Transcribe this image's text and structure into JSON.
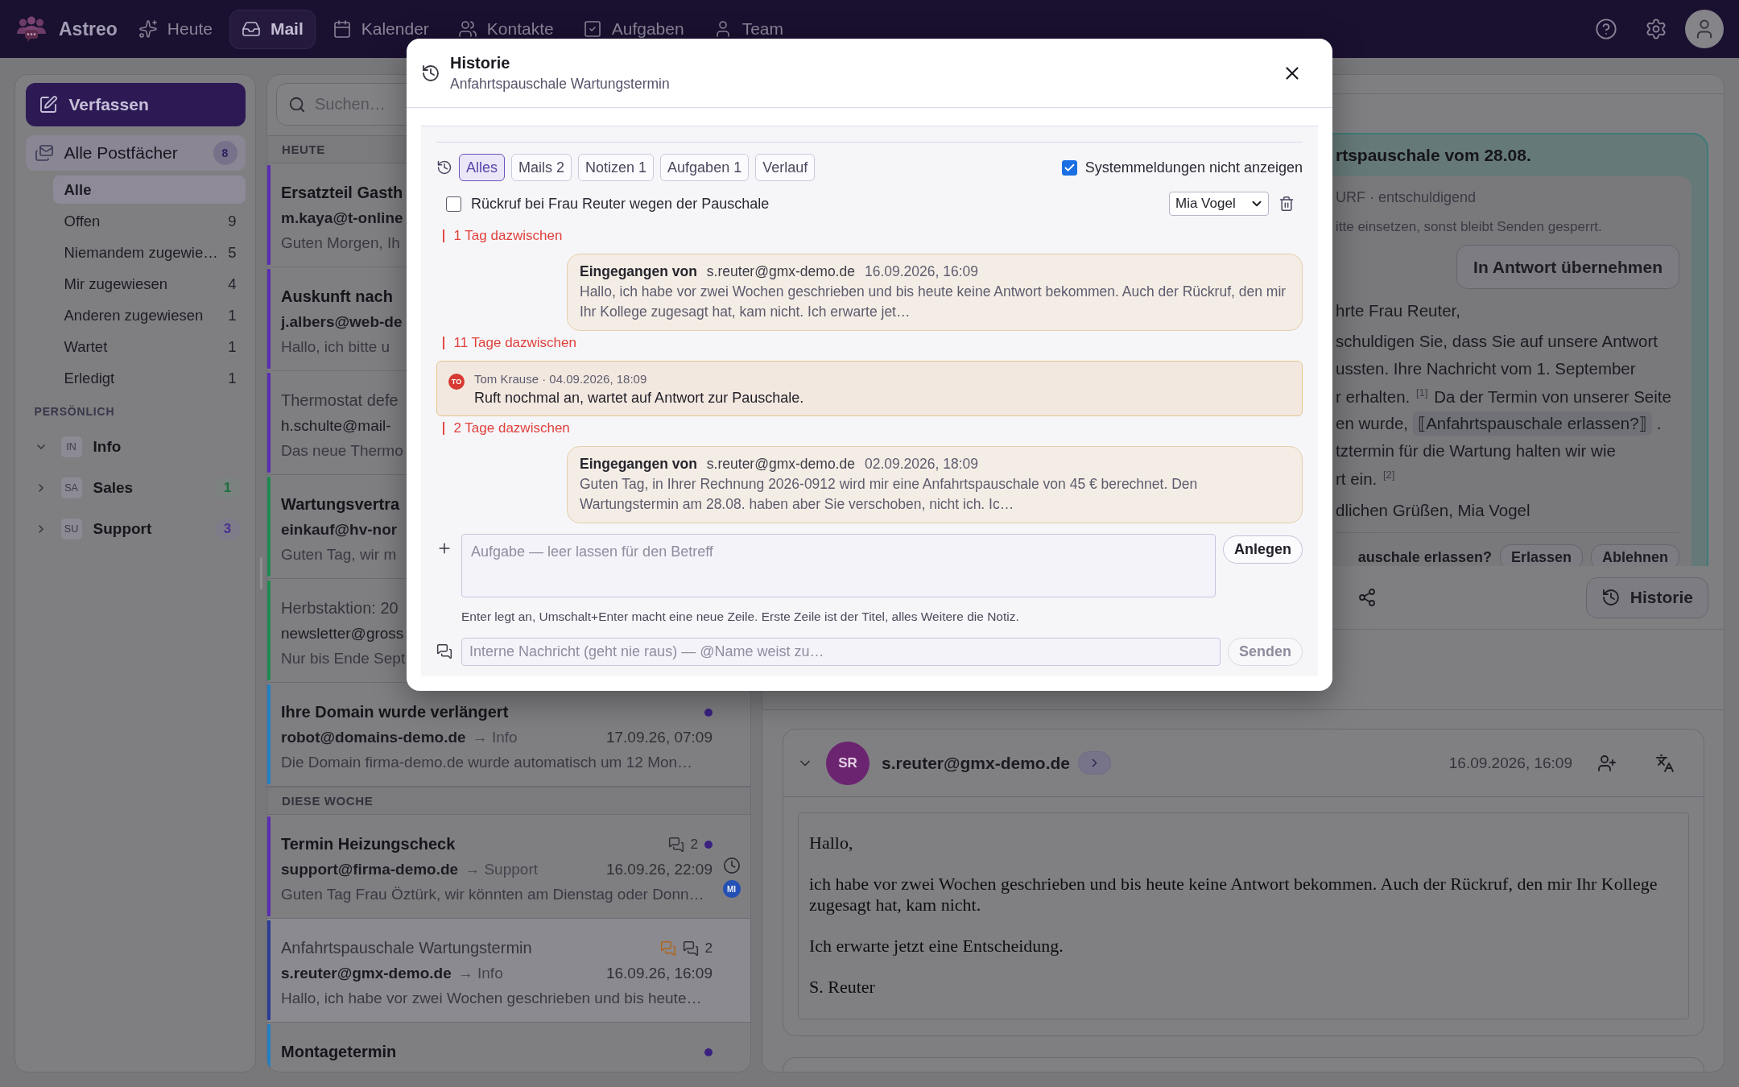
{
  "app": {
    "name": "Astreo"
  },
  "nav": [
    {
      "label": "Heute",
      "selected": false
    },
    {
      "label": "Mail",
      "selected": true
    },
    {
      "label": "Kalender",
      "selected": false
    },
    {
      "label": "Kontakte",
      "selected": false
    },
    {
      "label": "Aufgaben",
      "selected": false
    },
    {
      "label": "Team",
      "selected": false
    }
  ],
  "sidebar": {
    "compose": "Verfassen",
    "all_mailboxes": {
      "label": "Alle Postfächer",
      "count": "8",
      "selected": true
    },
    "filters": [
      {
        "label": "Alle",
        "selected": true
      },
      {
        "label": "Offen",
        "count": "9",
        "selected": false
      },
      {
        "label": "Niemandem zugewie…",
        "count": "5",
        "selected": false
      },
      {
        "label": "Mir zugewiesen",
        "count": "4",
        "selected": false
      },
      {
        "label": "Anderen zugewiesen",
        "count": "1",
        "selected": false
      },
      {
        "label": "Wartet",
        "count": "1",
        "selected": false
      },
      {
        "label": "Erledigt",
        "count": "1",
        "selected": false
      }
    ],
    "section": "PERSÖNLICH",
    "mailboxes": [
      {
        "code": "IN",
        "name": "Info",
        "expanded": true
      },
      {
        "code": "SA",
        "name": "Sales",
        "expanded": false,
        "count": "1",
        "color": "#1e6e42"
      },
      {
        "code": "SU",
        "name": "Support",
        "expanded": false,
        "count": "3",
        "color": "#4a2f8e"
      }
    ]
  },
  "list": {
    "search_placeholder": "Suchen…",
    "groups": [
      {
        "label": "HEUTE",
        "items": [
          {
            "title": "Ersatzteil Gasth",
            "sender": "m.kaya@t-online",
            "preview": "Guten Morgen, Ih",
            "unread": true,
            "dot": false,
            "note": false,
            "waiting": false,
            "selected": false,
            "color": "#5a2db3"
          },
          {
            "title": "Auskunft nach",
            "sender": "j.albers@web-de",
            "preview": "Hallo, ich bitte u",
            "unread": true,
            "dot": false,
            "note": false,
            "waiting": false,
            "selected": false,
            "color": "#5a2db3"
          },
          {
            "title": "Thermostat defe",
            "sender": "h.schulte@mail-",
            "preview": "Das neue Thermo",
            "unread": false,
            "dot": false,
            "note": false,
            "waiting": false,
            "selected": false,
            "color": "#5a2db3"
          },
          {
            "title": "Wartungsvertra",
            "sender": "einkauf@hv-nor",
            "preview": "Guten Tag, wir m",
            "unread": true,
            "dot": false,
            "note": false,
            "waiting": false,
            "selected": false,
            "color": "#1e8a50"
          },
          {
            "title": "Herbstaktion: 20",
            "sender": "newsletter@gross",
            "preview": "Nur bis Ende Sept",
            "unread": false,
            "dot": false,
            "note": false,
            "waiting": false,
            "selected": false,
            "color": "#1e8a50"
          },
          {
            "title": "Ihre Domain wurde verlängert",
            "sender": "robot@domains-demo.de",
            "mailbox": "→ Info",
            "date": "17.09.26, 07:09",
            "preview": "Die Domain firma-demo.de wurde automatisch um 12 Mon…",
            "unread": true,
            "dot": true,
            "note": false,
            "waiting": false,
            "selected": false,
            "color": "#2380c2"
          }
        ]
      },
      {
        "label": "DIESE WOCHE",
        "items": [
          {
            "title": "Termin Heizungscheck",
            "sender": "support@firma-demo.de",
            "mailbox": "→ Support",
            "date": "16.09.26, 22:09",
            "preview": "Guten Tag Frau Öztürk, wir könnten am Dienstag oder Donn…",
            "threads": "2",
            "assignee": "MI",
            "unread": true,
            "dot": true,
            "note": false,
            "waiting": true,
            "selected": false,
            "color": "#5a2db3"
          },
          {
            "title": "Anfahrtspauschale Wartungstermin",
            "sender": "s.reuter@gmx-demo.de",
            "mailbox": "→ Info",
            "date": "16.09.26, 16:09",
            "preview": "Hallo, ich habe vor zwei Wochen geschrieben und bis heute…",
            "threads": "2",
            "unread": false,
            "dot": false,
            "note": true,
            "waiting": false,
            "selected": true,
            "color": "#2b3c94"
          },
          {
            "title": "Montagetermin",
            "unread": true,
            "dot": true,
            "note": false,
            "waiting": false,
            "selected": false,
            "color": "#2380c2"
          }
        ]
      }
    ]
  },
  "reading": {
    "suggestion": {
      "title": "rtspauschale vom 28.08.",
      "meta": "URF · entschuldigend",
      "hint": "itte einsetzen, sonst bleibt Senden gesperrt.",
      "apply": "In Antwort übernehmen",
      "paragraphs": [
        {
          "lines": [
            {
              "kind": "text",
              "text": "hrte Frau Reuter,"
            }
          ]
        },
        {
          "lines": [
            {
              "kind": "text",
              "text": "schuldigen Sie, dass Sie auf unsere Antwort"
            },
            {
              "kind": "text",
              "text": "ussten. Ihre Nachricht vom 1. September"
            },
            {
              "kind": "text",
              "text": "r erhalten. $^{[1]}$ Da der Termin von unserer Seite"
            },
            {
              "kind": "gap",
              "before": "en wurde,",
              "gap": "⟦Anfahrtspauschale erlassen?⟧",
              "after": "."
            },
            {
              "kind": "text",
              "text": "tztermin für die Wartung halten wir wie"
            },
            {
              "kind": "text",
              "text": "rt ein. $^{[2]}$"
            }
          ]
        },
        {
          "lines": [
            {
              "kind": "text",
              "text": "dlichen Grüßen, Mia Vogel"
            }
          ]
        }
      ],
      "question": "auschale erlassen?",
      "actions": [
        "Erlassen",
        "Ablehnen"
      ]
    },
    "toolbar": {
      "history": "Historie"
    },
    "email": {
      "initials": "SR",
      "sender": "s.reuter@gmx-demo.de",
      "date": "16.09.2026, 16:09",
      "expanded": true,
      "body": [
        "Hallo,",
        "ich habe vor zwei Wochen geschrieben und bis heute keine Antwort bekommen. Auch der Rückruf, den mir Ihr Kollege zugesagt hat, kam nicht.",
        "Ich erwarte jetzt eine Entscheidung.",
        "S. Reuter"
      ]
    }
  },
  "history": {
    "title": "Historie",
    "subtitle": "Anfahrtspauschale Wartungstermin",
    "filters": [
      {
        "label": "Alles",
        "selected": true
      },
      {
        "label": "Mails 2",
        "selected": false
      },
      {
        "label": "Notizen 1",
        "selected": false
      },
      {
        "label": "Aufgaben 1",
        "selected": false
      },
      {
        "label": "Verlauf",
        "selected": false
      }
    ],
    "hide_system": {
      "label": "Systemmeldungen nicht anzeigen",
      "checked": true
    },
    "task": {
      "label": "Rückruf bei Frau Reuter wegen der Pauschale",
      "checked": false,
      "assignee": "Mia Vogel"
    },
    "timeline": [
      {
        "kind": "gap",
        "text": "1 Tag dazwischen"
      },
      {
        "kind": "mail",
        "label": "Eingegangen von",
        "from": "s.reuter@gmx-demo.de",
        "date": "16.09.2026, 16:09",
        "text": "Hallo, ich habe vor zwei Wochen geschrieben und bis heute keine Antwort bekommen. Auch der Rückruf, den mir Ihr Kollege zugesagt hat, kam nicht. Ich erwarte jet…"
      },
      {
        "kind": "gap",
        "text": "11 Tage dazwischen"
      },
      {
        "kind": "note",
        "initials": "TO",
        "meta": "Tom Krause · 04.09.2026, 18:09",
        "text": "Ruft nochmal an, wartet auf Antwort zur Pauschale."
      },
      {
        "kind": "gap",
        "text": "2 Tage dazwischen"
      },
      {
        "kind": "mail",
        "label": "Eingegangen von",
        "from": "s.reuter@gmx-demo.de",
        "date": "02.09.2026, 18:09",
        "text": "Guten Tag, in Ihrer Rechnung 2026-0912 wird mir eine Anfahrtspauschale von 45 € berechnet. Den Wartungstermin am 28.08. haben aber Sie verschoben, nicht ich. Ic…"
      }
    ],
    "task_input": {
      "placeholder": "Aufgabe — leer lassen für den Betreff",
      "button": {
        "label": "Anlegen",
        "disabled": false
      }
    },
    "hint": "Enter legt an, Umschalt+Enter macht eine neue Zeile. Erste Zeile ist der Titel, alles Weitere die Notiz.",
    "message_input": {
      "placeholder": "Interne Nachricht (geht nie raus) — @Name weist zu…",
      "button": {
        "label": "Senden",
        "disabled": true
      }
    }
  }
}
